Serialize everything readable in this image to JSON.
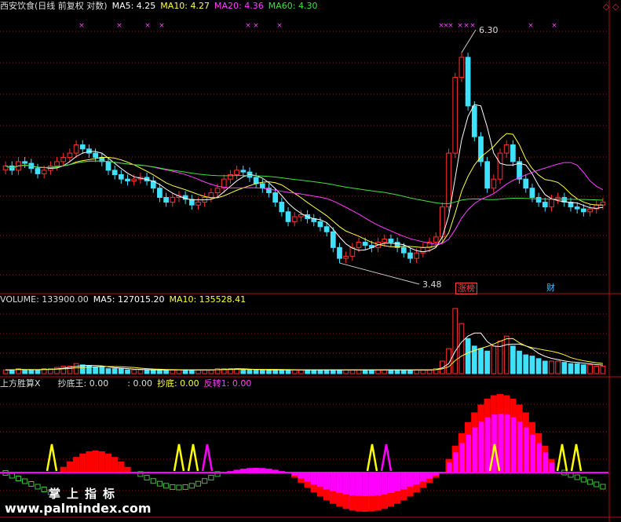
{
  "price_header": {
    "title": "西安饮食(日线 前复权 对数)",
    "ma5": "MA5: 4.25",
    "ma10": "MA10: 4.27",
    "ma20": "MA20: 4.36",
    "ma60": "MA60: 4.30"
  },
  "price_annotations": {
    "high_label": "6.30",
    "low_label": "3.48",
    "tag_limit": "涨榜",
    "tag_finance": "财"
  },
  "volume_header": {
    "volume": "VOLUME: 133900.00",
    "ma5": "MA5: 127015.20",
    "ma10": "MA10: 135528.41"
  },
  "indicator_header": {
    "name": "上方胜算X",
    "field1": "抄底王: 0.00",
    "field2": ": 0.00",
    "field3": "抄底: 0.00",
    "field4": "反转1: 0.00"
  },
  "watermark": {
    "title": "掌上指标",
    "url": "www.palmindex.com"
  },
  "colors": {
    "up": "#ff3030",
    "down": "#40e0ff",
    "ma5": "#ffffff",
    "ma10": "#ffff40",
    "ma20": "#ff40ff",
    "ma60": "#40e040",
    "grid": "#a01010",
    "magenta": "#ff00ff",
    "red_fill": "#ff0000",
    "yellow": "#ffff00",
    "green": "#40c040"
  },
  "chart_data": {
    "type": "candlestick",
    "price_range": [
      3.3,
      6.6
    ],
    "price_scale": "log",
    "closes": [
      4.45,
      4.4,
      4.5,
      4.48,
      4.42,
      4.36,
      4.4,
      4.45,
      4.5,
      4.55,
      4.6,
      4.7,
      4.65,
      4.6,
      4.55,
      4.5,
      4.4,
      4.35,
      4.3,
      4.28,
      4.3,
      4.32,
      4.28,
      4.2,
      4.1,
      4.05,
      4.1,
      4.12,
      4.08,
      4.02,
      4.05,
      4.1,
      4.15,
      4.2,
      4.3,
      4.35,
      4.4,
      4.38,
      4.32,
      4.25,
      4.2,
      4.15,
      4.05,
      3.95,
      3.85,
      3.9,
      3.92,
      3.88,
      3.85,
      3.8,
      3.75,
      3.6,
      3.5,
      3.52,
      3.6,
      3.65,
      3.62,
      3.6,
      3.65,
      3.68,
      3.65,
      3.6,
      3.55,
      3.5,
      3.55,
      3.6,
      3.65,
      3.7,
      4.0,
      4.6,
      5.6,
      5.9,
      5.2,
      4.8,
      4.5,
      4.2,
      4.3,
      4.6,
      4.7,
      4.5,
      4.3,
      4.2,
      4.1,
      4.05,
      4.0,
      4.08,
      4.1,
      4.05,
      4.0,
      3.98,
      3.95,
      3.98,
      4.02,
      4.05
    ],
    "volumes": [
      3,
      3,
      4,
      3,
      3,
      3,
      4,
      4,
      5,
      6,
      6,
      8,
      7,
      6,
      5,
      5,
      4,
      4,
      4,
      3,
      3,
      3,
      3,
      3,
      3,
      3,
      3,
      3,
      3,
      3,
      3,
      3,
      3,
      4,
      4,
      4,
      4,
      3,
      3,
      3,
      3,
      3,
      3,
      3,
      3,
      3,
      3,
      3,
      3,
      3,
      3,
      3,
      3,
      3,
      3,
      3,
      3,
      3,
      3,
      3,
      3,
      3,
      3,
      3,
      3,
      3,
      3,
      4,
      10,
      20,
      52,
      40,
      28,
      22,
      20,
      18,
      22,
      26,
      30,
      22,
      18,
      15,
      14,
      12,
      10,
      10,
      10,
      9,
      8,
      8,
      7,
      7,
      6,
      6
    ]
  }
}
